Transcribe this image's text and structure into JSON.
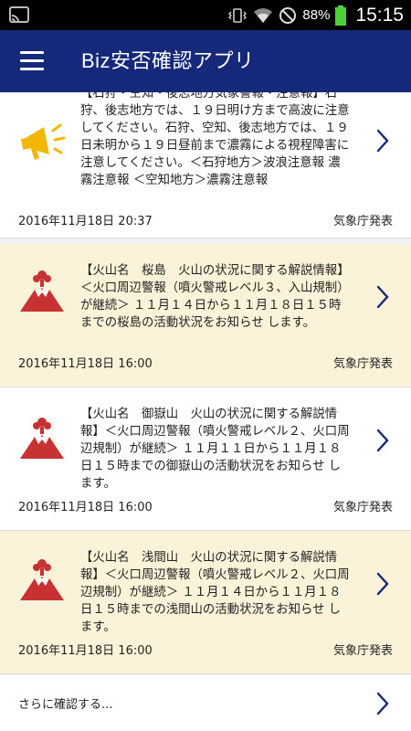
{
  "status_bar": {
    "battery_percent": "88%",
    "time": "15:15"
  },
  "app_bar": {
    "title": "Biz安否確認アプリ",
    "menu_icon": "hamburger-menu-icon"
  },
  "colors": {
    "app_bar": "#16287a",
    "highlight_card": "#fbf3d9",
    "chevron": "#16287a",
    "megaphone": "#f2b705",
    "volcano": "#c83232"
  },
  "cards": [
    {
      "icon": "megaphone-icon",
      "highlighted": false,
      "text": "【石狩・空知・後志地方気象警報・注意報】石狩、後志地方では、１９日明け方まで高波に注意してください。石狩、空知、後志地方では、１９日未明から１９日昼前まで濃霧による視程障害に注意してください。＜石狩地方＞波浪注意報 濃霧注意報 ＜空知地方＞濃霧注意報",
      "date": "2016年11月18日 20:37",
      "source": "気象庁発表"
    },
    {
      "icon": "volcano-icon",
      "highlighted": true,
      "text": "【火山名　桜島　火山の状況に関する解説情報】＜火口周辺警報（噴火警戒レベル３、入山規制）が継続＞ １１月１４日から１１月１８日１５時までの桜島の活動状況をお知らせ します。",
      "date": "2016年11月18日 16:00",
      "source": "気象庁発表"
    },
    {
      "icon": "volcano-icon",
      "highlighted": false,
      "text": "【火山名　御嶽山　火山の状況に関する解説情報】＜火口周辺警報（噴火警戒レベル２、火口周辺規制）が継続＞ １１月１１日から１１月１８日１５時までの御嶽山の活動状況をお知らせ します。",
      "date": "2016年11月18日 16:00",
      "source": "気象庁発表"
    },
    {
      "icon": "volcano-icon",
      "highlighted": true,
      "text": "【火山名　浅間山　火山の状況に関する解説情報】＜火口周辺警報（噴火警戒レベル２、火口周辺規制）が継続＞ １１月１４日から１１月１８日１５時までの浅間山の活動状況をお知らせ します。",
      "date": "2016年11月18日 16:00",
      "source": "気象庁発表"
    }
  ],
  "more": {
    "label": "さらに確認する..."
  }
}
